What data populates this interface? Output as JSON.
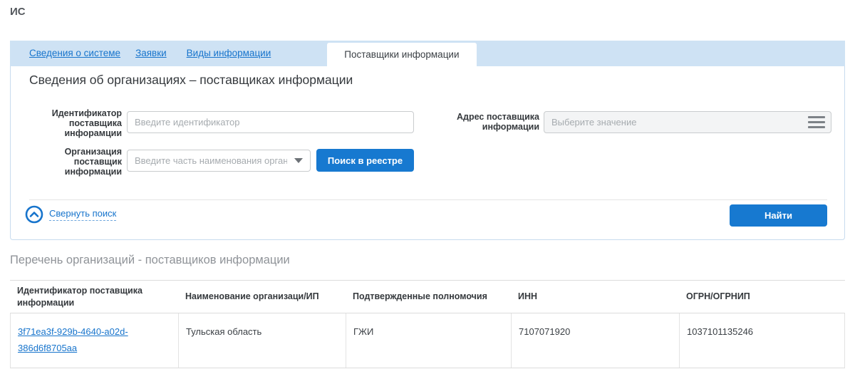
{
  "page": {
    "title": "ИС"
  },
  "tabs": {
    "items": [
      {
        "label": "Сведения о системе",
        "active": false
      },
      {
        "label": "Заявки",
        "active": false
      },
      {
        "label": "Виды информации",
        "active": false
      },
      {
        "label": "Поставщики информации",
        "active": true
      }
    ]
  },
  "search_panel": {
    "heading": "Сведения об организациях – поставщиках информации",
    "fields": {
      "identifier": {
        "label": "Идентификатор поставщика инфорамции",
        "value": "",
        "placeholder": "Введите идентификатор"
      },
      "address": {
        "label": "Адрес поставщика информации",
        "value": "",
        "placeholder": "Выберите значение",
        "icon": "menu-icon"
      },
      "organization": {
        "label": "Организация поставщик информации",
        "value": "",
        "placeholder": "Введите часть наименования органи…",
        "icon": "chevron-down-icon"
      }
    },
    "registry_search_button": "Поиск в реестре",
    "collapse_link": "Свернуть поиск",
    "collapse_icon": "chevron-up-circle-icon",
    "find_button": "Найти"
  },
  "results": {
    "heading": "Перечень организаций - поставщиков информации",
    "table": {
      "headers": [
        "Идентификатор поставщика информации",
        "Наименование организаци/ИП",
        "Подтвержденные полномочия",
        "ИНН",
        "ОГРН/ОГРНИП"
      ],
      "rows": [
        {
          "id": "3f71ea3f-929b-4640-a02d-386d6f8705aa",
          "name": "Тульская область",
          "authority": "ГЖИ",
          "inn": "7107071920",
          "ogrn": "1037101135246"
        }
      ]
    }
  },
  "colors": {
    "accent_link": "#1774cc",
    "button_blue": "#1779d0",
    "tab_bar_blue": "#cee2f4",
    "panel_border": "#c7dbee",
    "placeholder_gray": "#a6abaf",
    "muted_heading_gray": "#8f9398"
  }
}
